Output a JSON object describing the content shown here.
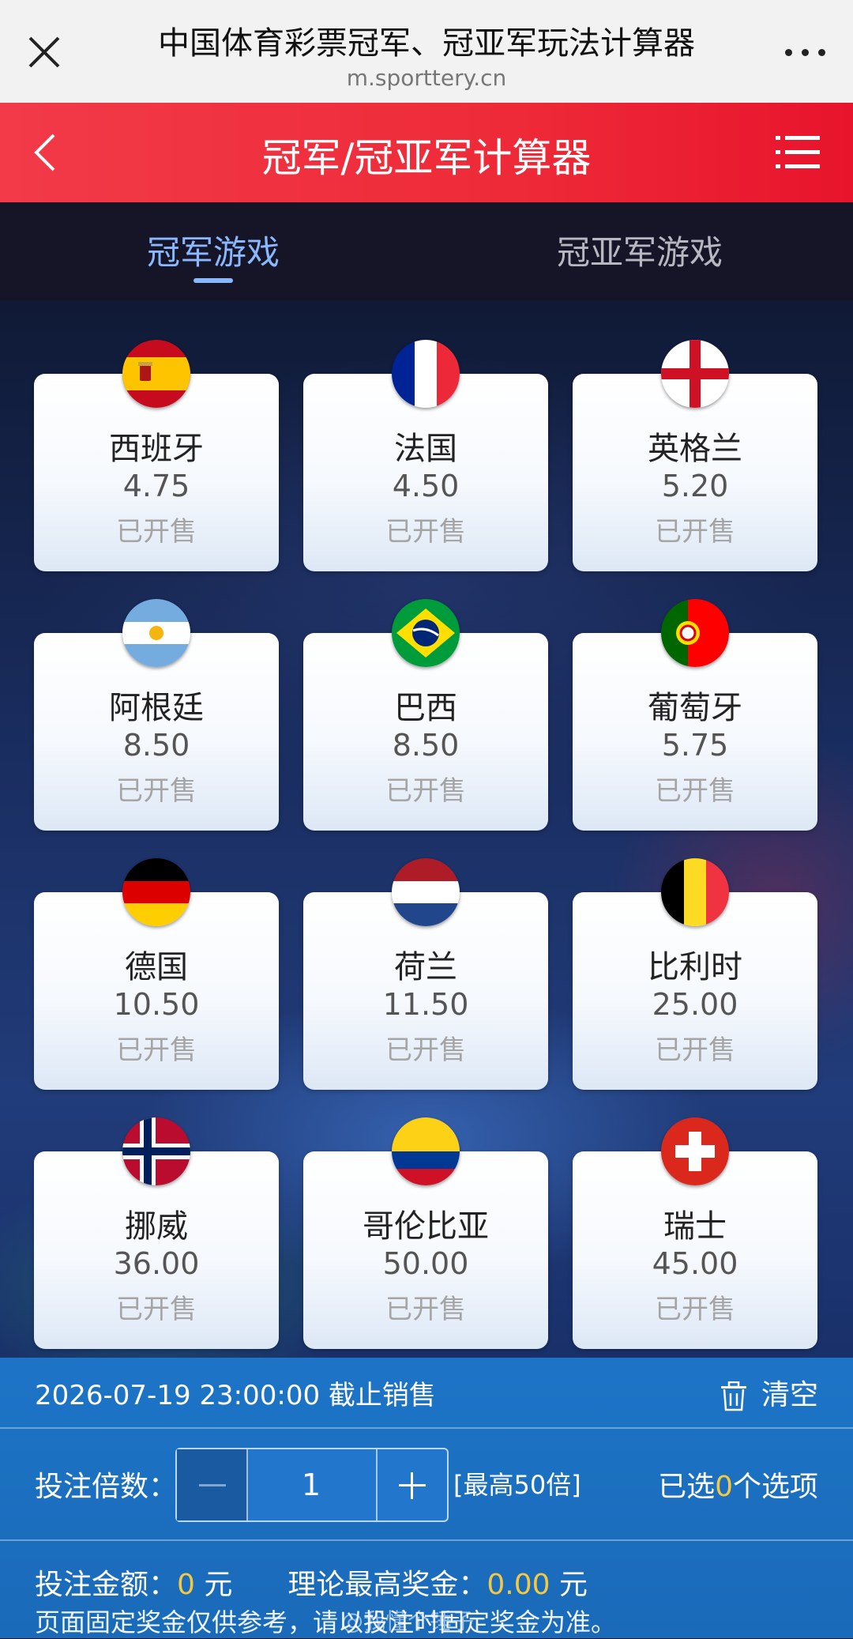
{
  "browser": {
    "title": "中国体育彩票冠军、冠亚军玩法计算器",
    "url": "m.sporttery.cn"
  },
  "header": {
    "title": "冠军/冠亚军计算器"
  },
  "tabs": [
    {
      "label": "冠军游戏",
      "active": true
    },
    {
      "label": "冠亚军游戏",
      "active": false
    }
  ],
  "teams": [
    {
      "name": "西班牙",
      "odds": "4.75",
      "status": "已开售",
      "flag": "spain-flag-icon"
    },
    {
      "name": "法国",
      "odds": "4.50",
      "status": "已开售",
      "flag": "france-flag-icon"
    },
    {
      "name": "英格兰",
      "odds": "5.20",
      "status": "已开售",
      "flag": "england-flag-icon"
    },
    {
      "name": "阿根廷",
      "odds": "8.50",
      "status": "已开售",
      "flag": "argentina-flag-icon"
    },
    {
      "name": "巴西",
      "odds": "8.50",
      "status": "已开售",
      "flag": "brazil-flag-icon"
    },
    {
      "name": "葡萄牙",
      "odds": "5.75",
      "status": "已开售",
      "flag": "portugal-flag-icon"
    },
    {
      "name": "德国",
      "odds": "10.50",
      "status": "已开售",
      "flag": "germany-flag-icon"
    },
    {
      "name": "荷兰",
      "odds": "11.50",
      "status": "已开售",
      "flag": "netherlands-flag-icon"
    },
    {
      "name": "比利时",
      "odds": "25.00",
      "status": "已开售",
      "flag": "belgium-flag-icon"
    },
    {
      "name": "挪威",
      "odds": "36.00",
      "status": "已开售",
      "flag": "norway-flag-icon"
    },
    {
      "name": "哥伦比亚",
      "odds": "50.00",
      "status": "已开售",
      "flag": "colombia-flag-icon"
    },
    {
      "name": "瑞士",
      "odds": "45.00",
      "status": "已开售",
      "flag": "switzerland-flag-icon"
    }
  ],
  "bet_panel": {
    "deadline": "2026-07-19 23:00:00 截止销售",
    "clear_label": "清空",
    "multiplier_label": "投注倍数：",
    "multiplier_value": "1",
    "max_hint": "[最高50倍]",
    "selected_prefix": "已选",
    "selected_count": "0",
    "selected_suffix": "个选项",
    "amount_label": "投注金额：",
    "amount_value": "0",
    "amount_unit": "元",
    "max_prize_label": "理论最高奖金：",
    "max_prize_value": "0.00",
    "max_prize_unit": "元",
    "disclaimer": "页面固定奖金仅供参考，请以投注时固定奖金为准。",
    "watermark": "@我懂个锤子"
  },
  "colors": {
    "header_red": "#ee2a38",
    "tab_active": "#8ab8ff",
    "panel_blue": "#1d74c6",
    "highlight_yellow": "#f5c842"
  }
}
